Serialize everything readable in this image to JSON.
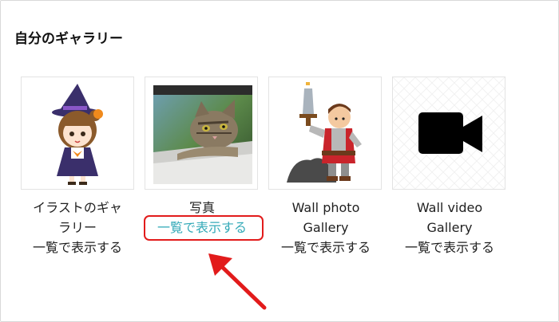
{
  "page": {
    "title": "自分のギャラリー"
  },
  "galleries": [
    {
      "name_lines": [
        "イラストのギャ",
        "ラリー"
      ],
      "link": "一覧で表示する",
      "thumb": "halloween-girl-illustration"
    },
    {
      "name_lines": [
        "写真"
      ],
      "link": "一覧で表示する",
      "thumb": "cat-photo"
    },
    {
      "name_lines": [
        "Wall photo",
        "Gallery"
      ],
      "link": "一覧で表示する",
      "thumb": "warrior-illustration"
    },
    {
      "name_lines": [
        "Wall video",
        "Gallery"
      ],
      "link": "一覧で表示する",
      "thumb": "video-camera-icon"
    }
  ],
  "annotation": {
    "highlight_color": "#e21b1b",
    "link_color": "#34aab8"
  }
}
